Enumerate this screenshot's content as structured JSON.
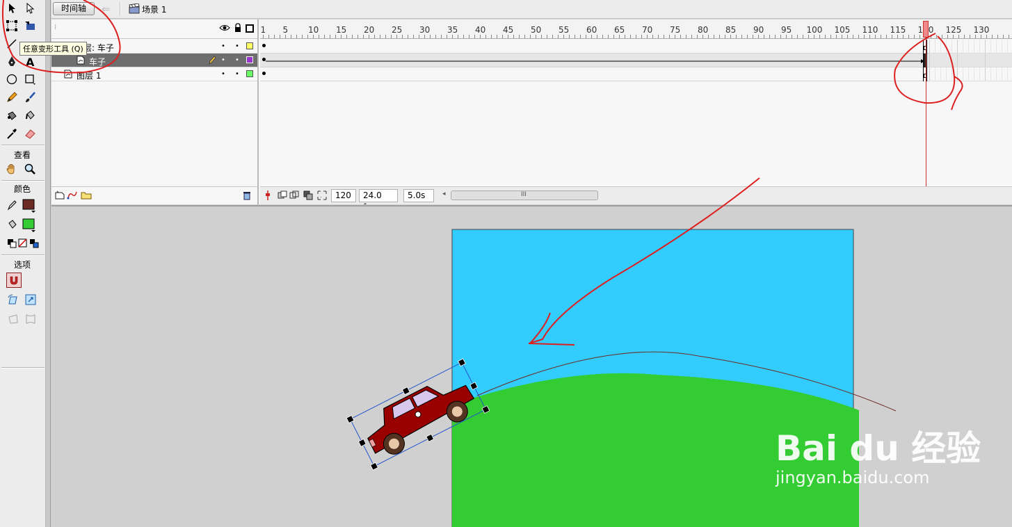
{
  "tools_panel": {
    "tooltip": "任意变形工具 (Q)",
    "sections": {
      "view": "查看",
      "colors": "颜色",
      "options": "选项"
    },
    "stroke_color": "#6b2a23",
    "fill_color": "#33cc33"
  },
  "topbar": {
    "timeline_button": "时间轴",
    "scene_label": "场景 1"
  },
  "timeline": {
    "layers": [
      {
        "name": "引导层: 车子",
        "color": "#ffff66",
        "selected": false
      },
      {
        "name": "车子",
        "color": "#9933cc",
        "selected": true
      },
      {
        "name": "图层 1",
        "color": "#66ff66",
        "selected": false
      }
    ],
    "frame_numbers": [
      "1",
      "5",
      "10",
      "15",
      "20",
      "25",
      "30",
      "35",
      "40",
      "45",
      "50",
      "55",
      "60",
      "65",
      "70",
      "75",
      "80",
      "85",
      "90",
      "95",
      "100",
      "105",
      "110",
      "115",
      "120",
      "125",
      "130"
    ],
    "current_frame": "120",
    "fps": "24.0 fps",
    "elapsed_time": "5.0s",
    "scroll_grip": "III"
  },
  "stage": {
    "sky_color": "#33ccff",
    "ground_color": "#33cc33",
    "car_body_color": "#990000"
  },
  "watermark": {
    "brand": "Bai du 经验",
    "url": "jingyan.baidu.com"
  }
}
